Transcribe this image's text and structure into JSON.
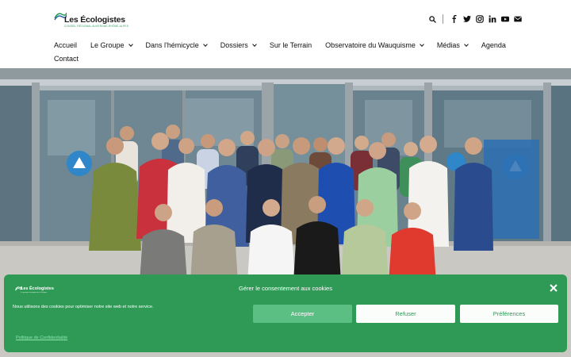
{
  "site": {
    "logo_name": "Les Écologistes",
    "logo_tagline": "CONSEIL RÉGIONAL AUVERGNE-RHÔNE-ALPES"
  },
  "header": {
    "icons": [
      "search-icon",
      "facebook-icon",
      "twitter-icon",
      "instagram-icon",
      "linkedin-icon",
      "youtube-icon",
      "mail-icon"
    ]
  },
  "nav": {
    "items": [
      {
        "label": "Accueil",
        "dropdown": false
      },
      {
        "label": "Le Groupe",
        "dropdown": true
      },
      {
        "label": "Dans l'hémicycle",
        "dropdown": true
      },
      {
        "label": "Dossiers",
        "dropdown": true
      },
      {
        "label": "Sur le Terrain",
        "dropdown": false
      },
      {
        "label": "Observatoire du Wauquisme",
        "dropdown": true
      },
      {
        "label": "Médias",
        "dropdown": true
      },
      {
        "label": "Agenda",
        "dropdown": false
      },
      {
        "label": "Contact",
        "dropdown": false
      }
    ]
  },
  "cookie_banner": {
    "title": "Gérer le consentement aux cookies",
    "text": "Nous utilisons des cookies pour optimiser notre site web et notre service.",
    "accept_label": "Accepter",
    "refuse_label": "Refuser",
    "preferences_label": "Préférences",
    "policy_link": "Politique de Confidentialité",
    "logo_name": "Les Écologistes",
    "logo_tagline": "Le groupe écologiste de la Région"
  },
  "colors": {
    "brand_green": "#2e9a56",
    "accept_button": "#5bbf83",
    "link_green": "#8fe3b0"
  }
}
